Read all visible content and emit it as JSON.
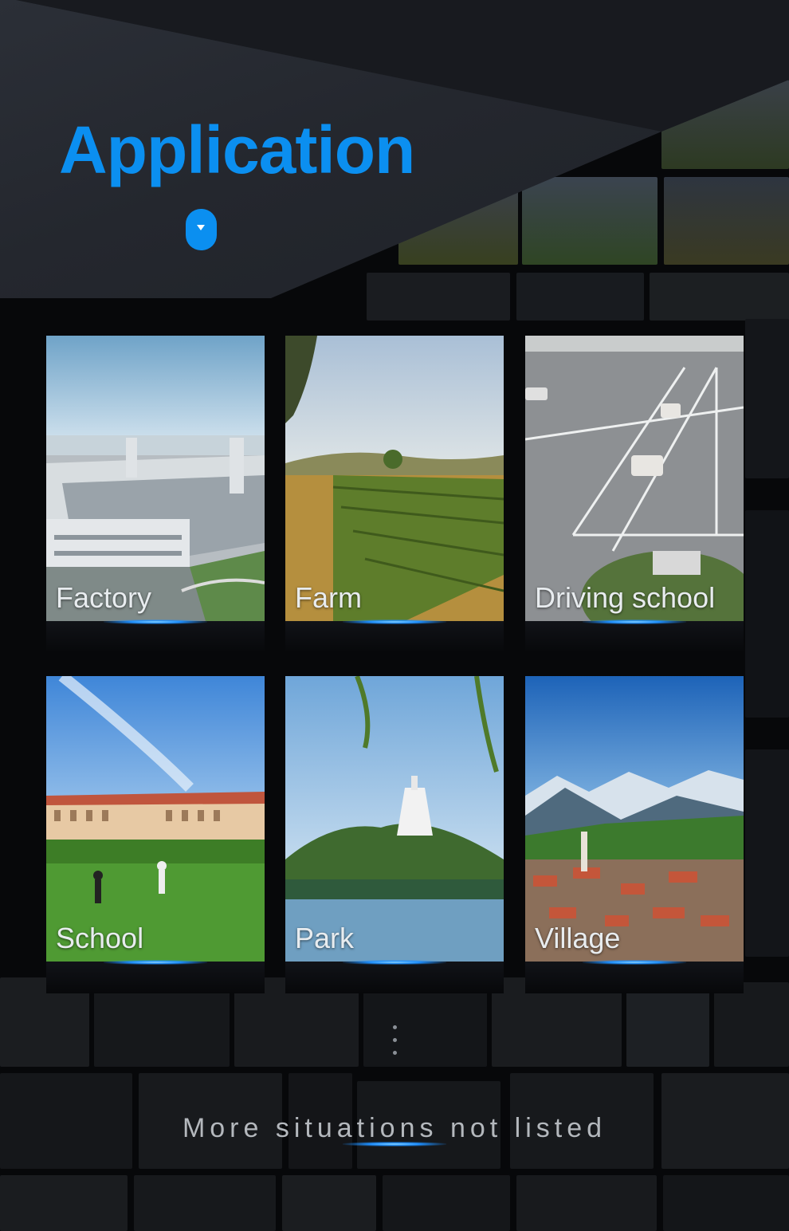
{
  "header": {
    "title": "Application",
    "toggle_icon": "chevron-down-icon"
  },
  "accent_color": "#0b8ff0",
  "cards": [
    {
      "label": "Factory",
      "image": "factory-photo"
    },
    {
      "label": "Farm",
      "image": "farm-photo"
    },
    {
      "label": "Driving school",
      "image": "driving-school-photo"
    },
    {
      "label": "School",
      "image": "school-photo"
    },
    {
      "label": "Park",
      "image": "park-photo"
    },
    {
      "label": "Village",
      "image": "village-photo"
    }
  ],
  "footer": {
    "more_text": "More situations not listed"
  }
}
